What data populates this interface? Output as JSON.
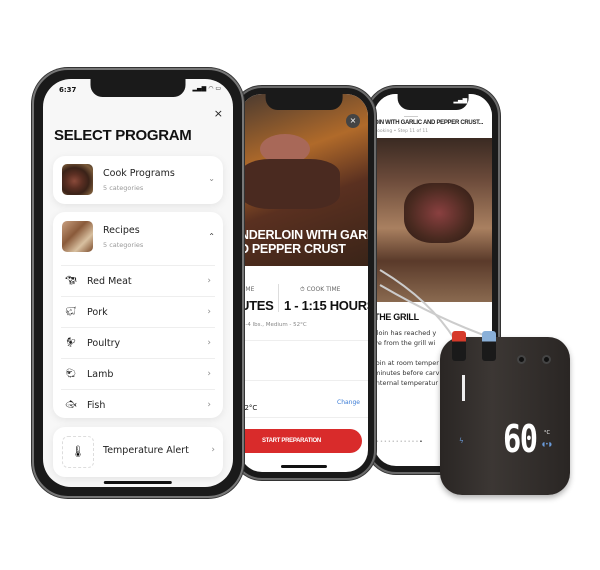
{
  "phone_back": {
    "header_title": "OIN WITH GARLIC AND PEPPER CRUST...",
    "header_subtitle": "Cooking • Step 11 of 11",
    "section_title": "THE GRILL",
    "body_lines": [
      "rloin has reached y",
      "ve from the grill wi",
      "",
      "loin at room temper",
      "minutes before carv",
      "internal temperatur"
    ],
    "step_count": 11,
    "current_step": 11
  },
  "phone_middle": {
    "recipe_title_line1": "NDERLOIN WITH GARLIC",
    "recipe_title_line2": "D PEPPER CRUST",
    "prep_label": "TIME",
    "prep_value": "UTES",
    "cook_label": "COOK TIME",
    "cook_value": "1 - 1:15 HOURS",
    "details": "½-4 lbs., Medium -  52°C",
    "target_temp": "52°C",
    "change_link": "Change",
    "start_button": "START PREPARATION",
    "close_icon": "close-icon",
    "accent_color": "#d92b2b",
    "link_color": "#3a7bd5"
  },
  "phone_front": {
    "status_time": "6:37",
    "title": "SELECT PROGRAM",
    "close_icon": "close-icon",
    "cook_programs": {
      "label": "Cook Programs",
      "sub": "5 categories"
    },
    "recipes": {
      "label": "Recipes",
      "sub": "5 categories"
    },
    "categories": [
      {
        "label": "Red Meat",
        "icon": "cow-icon"
      },
      {
        "label": "Pork",
        "icon": "pig-icon"
      },
      {
        "label": "Poultry",
        "icon": "chicken-icon"
      },
      {
        "label": "Lamb",
        "icon": "lamb-icon"
      },
      {
        "label": "Fish",
        "icon": "fish-icon"
      }
    ],
    "temperature_alert": "Temperature Alert"
  },
  "device": {
    "display_value": "60",
    "unit": "°C"
  }
}
